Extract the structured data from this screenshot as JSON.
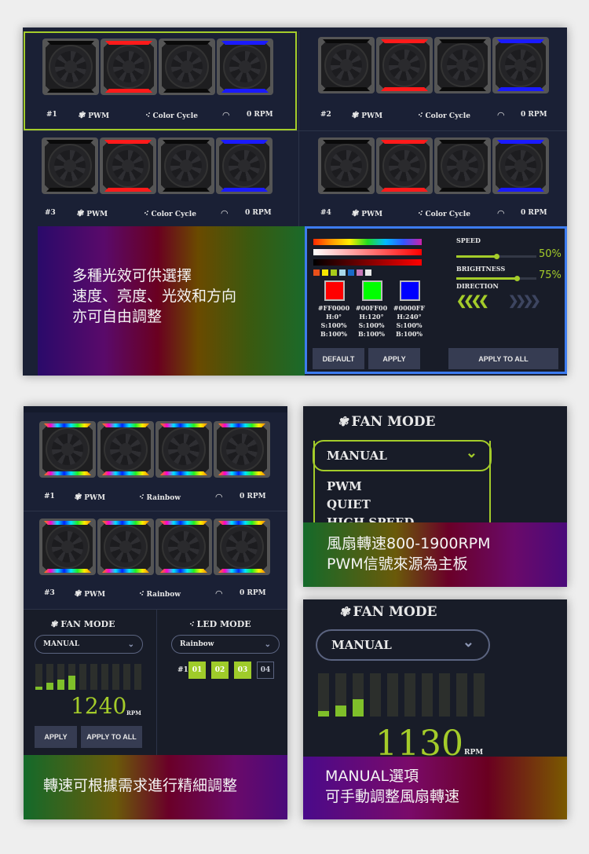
{
  "top_panel": {
    "fan_groups": [
      {
        "id": "#1",
        "fan_mode": "PWM",
        "led_mode": "Color Cycle",
        "rpm": "0 RPM",
        "leds": [
          "none",
          "red",
          "none",
          "blue"
        ],
        "selected": true
      },
      {
        "id": "#2",
        "fan_mode": "PWM",
        "led_mode": "Color Cycle",
        "rpm": "0 RPM",
        "leds": [
          "none",
          "red",
          "none",
          "blue"
        ],
        "selected": false
      },
      {
        "id": "#3",
        "fan_mode": "PWM",
        "led_mode": "Color Cycle",
        "rpm": "0 RPM",
        "leds": [
          "none",
          "red",
          "none",
          "blue"
        ],
        "selected": false
      },
      {
        "id": "#4",
        "fan_mode": "PWM",
        "led_mode": "Color Cycle",
        "rpm": "0 RPM",
        "leds": [
          "none",
          "red",
          "none",
          "blue"
        ],
        "selected": false
      }
    ],
    "caption": [
      "多種光效可供選擇",
      "速度、亮度、光效和方向",
      "亦可自由調整"
    ],
    "color_editor": {
      "preset_swatches": [
        "#e8501a",
        "#f5e600",
        "#a8cc1a",
        "#a8d8ea",
        "#1a6ac8",
        "#c878b8",
        "#e8e8e8"
      ],
      "colors": [
        {
          "hex": "#FF0000",
          "h": "H:0°",
          "s": "S:100%",
          "b": "B:100%",
          "value": "#ff0000"
        },
        {
          "hex": "#00FF00",
          "h": "H:120°",
          "s": "S:100%",
          "b": "B:100%",
          "value": "#00ff00"
        },
        {
          "hex": "#0000FF",
          "h": "H:240°",
          "s": "S:100%",
          "b": "B:100%",
          "value": "#0000ff"
        }
      ],
      "speed_label": "SPEED",
      "speed_value": "50%",
      "speed_fraction": 0.5,
      "brightness_label": "BRIGHTNESS",
      "brightness_value": "75%",
      "brightness_fraction": 0.75,
      "direction_label": "DIRECTION",
      "direction_left": "❮❮❮❮",
      "direction_right": "❯❯❯❯",
      "default_button": "DEFAULT",
      "apply_button": "APPLY",
      "apply_all_button": "APPLY TO ALL"
    }
  },
  "bottom_left": {
    "fan_groups": [
      {
        "id": "#1",
        "fan_mode": "PWM",
        "led_mode": "Rainbow",
        "rpm": "0 RPM"
      },
      {
        "id": "#3",
        "fan_mode": "PWM",
        "led_mode": "Rainbow",
        "rpm": "0 RPM"
      }
    ],
    "fan_mode_title": "FAN MODE",
    "fan_mode_value": "MANUAL",
    "fan_levels_filled": 4,
    "fan_levels_total": 10,
    "rpm_value": "1240",
    "rpm_unit": "RPM",
    "apply_button": "APPLY",
    "apply_all_button": "APPLY TO ALL",
    "led_mode_title": "LED MODE",
    "led_mode_value": "Rainbow",
    "led_group_label": "#1",
    "led_channels": [
      {
        "label": "01",
        "on": true
      },
      {
        "label": "02",
        "on": true
      },
      {
        "label": "03",
        "on": true
      },
      {
        "label": "04",
        "on": false
      }
    ],
    "caption": "轉速可根據需求進行精細調整"
  },
  "bottom_right_top": {
    "fan_mode_title": "FAN MODE",
    "dropdown_value": "MANUAL",
    "options": [
      "PWM",
      "QUIET",
      "HIGH SPEED"
    ],
    "caption": [
      "風扇轉速800-1900RPM",
      "PWM信號來源為主板"
    ]
  },
  "bottom_right_bottom": {
    "fan_mode_title": "FAN MODE",
    "dropdown_value": "MANUAL",
    "fan_levels_filled": 3,
    "fan_levels_total": 10,
    "rpm_value": "1130",
    "rpm_unit": "RPM",
    "caption": [
      "MANUAL選項",
      "可手動調整風扇轉速"
    ]
  },
  "icons": {
    "fan": "✾",
    "led": "⁖",
    "gauge": "◠",
    "chevron": "⌄"
  }
}
